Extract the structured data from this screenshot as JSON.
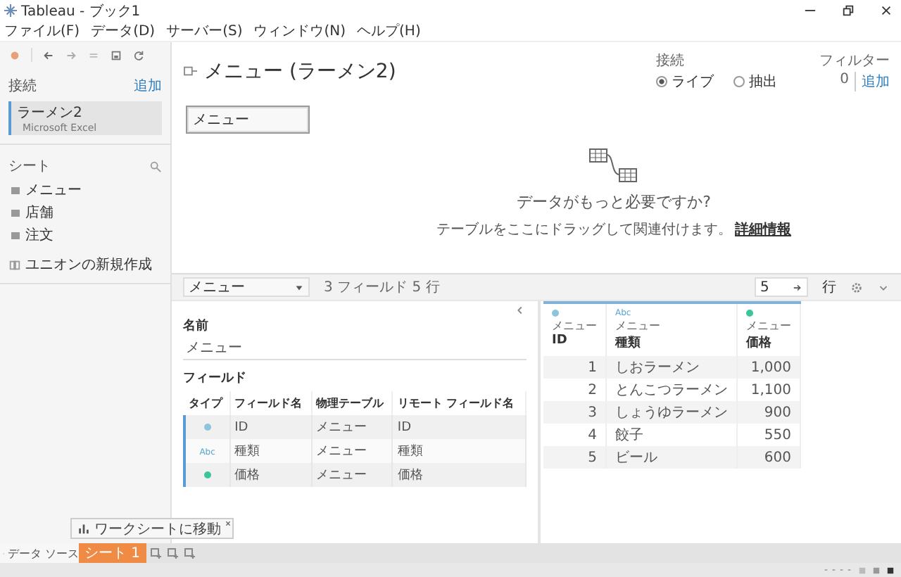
{
  "window": {
    "title": "Tableau - ブック1"
  },
  "menu": [
    "ファイル(F)",
    "データ(D)",
    "サーバー(S)",
    "ウィンドウ(N)",
    "ヘルプ(H)"
  ],
  "sidebar": {
    "connections_label": "接続",
    "add_link": "追加",
    "connection": {
      "name": "ラーメン2",
      "type": "Microsoft Excel",
      "selected": true
    },
    "sheets_label": "シート",
    "sheets": [
      {
        "name": "メニュー"
      },
      {
        "name": "店舗"
      },
      {
        "name": "注文"
      }
    ],
    "new_union": "ユニオンの新規作成"
  },
  "canvas": {
    "title": "メニュー (ラーメン2)",
    "connection_label": "接続",
    "modes": [
      {
        "label": "ライブ",
        "selected": true
      },
      {
        "label": "抽出",
        "selected": false
      }
    ],
    "filter_label": "フィルター",
    "filter_count": "0",
    "filter_add": "追加",
    "tables": [
      {
        "name": "メニュー"
      }
    ],
    "prompt": "データがもっと必要ですか?",
    "hint": "テーブルをここにドラッグして関連付けます。",
    "hint_link": "詳細情報"
  },
  "data_toolbar": {
    "table_select": "メニュー",
    "summary": "3 フィールド 5 行",
    "rows_value": "5",
    "rows_label": "行"
  },
  "metadata": {
    "name_label": "名前",
    "name_value": "メニュー",
    "fields_label": "フィールド",
    "columns": [
      "タイプ",
      "フィールド名",
      "物理テーブル",
      "リモート フィールド名"
    ],
    "rows": [
      {
        "kind": "dot",
        "color": "#8ec3dc",
        "field": "ID",
        "table": "メニュー",
        "remote": "ID"
      },
      {
        "kind": "text",
        "glyph": "Abc",
        "field": "種類",
        "table": "メニュー",
        "remote": "種類"
      },
      {
        "kind": "dot",
        "color": "#3cc49a",
        "field": "価格",
        "table": "メニュー",
        "remote": "価格"
      }
    ]
  },
  "grid": {
    "columns": [
      {
        "kind": "dot",
        "color": "#8ec3dc",
        "table": "メニュー",
        "name": "ID"
      },
      {
        "kind": "text",
        "glyph": "Abc",
        "table": "メニュー",
        "name": "種類"
      },
      {
        "kind": "dot",
        "color": "#3cc49a",
        "table": "メニュー",
        "name": "価格"
      }
    ],
    "rows": [
      [
        "1",
        "しおラーメン",
        "1,000"
      ],
      [
        "2",
        "とんこつラーメン",
        "1,100"
      ],
      [
        "3",
        "しょうゆラーメン",
        "900"
      ],
      [
        "4",
        "餃子",
        "550"
      ],
      [
        "5",
        "ビール",
        "600"
      ]
    ]
  },
  "bottom": {
    "data_source_tab": "データ ソース",
    "sheets": [
      {
        "label": "シート 1",
        "selected": true
      }
    ],
    "tooltip": "ワークシートに移動"
  }
}
